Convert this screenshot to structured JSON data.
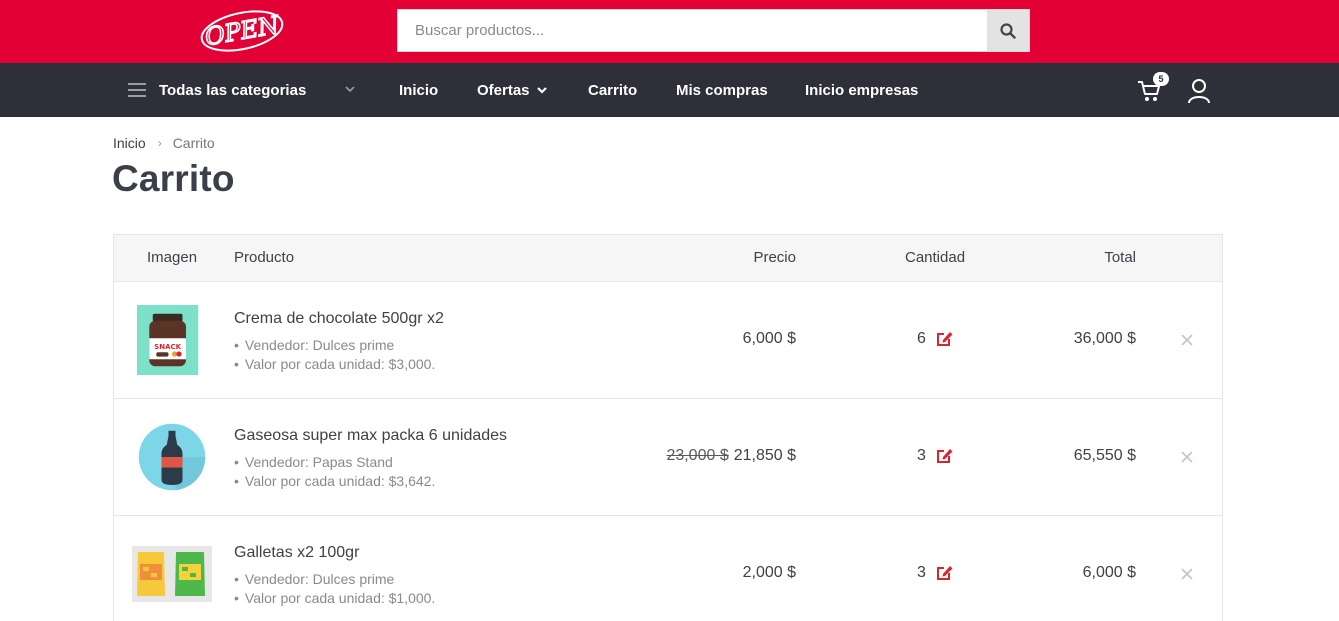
{
  "header": {
    "logo_text": "OPEN",
    "search_placeholder": "Buscar productos..."
  },
  "nav": {
    "categories_label": "Todas las categorias",
    "items": [
      {
        "label": "Inicio"
      },
      {
        "label": "Ofertas"
      },
      {
        "label": "Carrito"
      },
      {
        "label": "Mis compras"
      },
      {
        "label": "Inicio empresas"
      }
    ],
    "cart_count": "5"
  },
  "breadcrumb": {
    "home": "Inicio",
    "current": "Carrito"
  },
  "page_title": "Carrito",
  "table": {
    "headers": {
      "image": "Imagen",
      "product": "Producto",
      "price": "Precio",
      "quantity": "Cantidad",
      "total": "Total"
    },
    "rows": [
      {
        "image": "nutella-jar-image",
        "name": "Crema de chocolate 500gr x2",
        "vendor": "Vendedor: Dulces prime",
        "unit_value": "Valor por cada unidad: $3,000.",
        "old_price": "",
        "price": "6,000 $",
        "quantity": "6",
        "total": "36,000 $"
      },
      {
        "image": "soda-bottle-image",
        "name": "Gaseosa super max packa 6 unidades",
        "vendor": "Vendedor: Papas Stand",
        "unit_value": "Valor por cada unidad: $3,642.",
        "old_price": "23,000 $",
        "price": "21,850 $",
        "quantity": "3",
        "total": "65,550 $"
      },
      {
        "image": "snack-bags-image",
        "name": "Galletas x2 100gr",
        "vendor": "Vendedor: Dulces prime",
        "unit_value": "Valor por cada unidad: $1,000.",
        "old_price": "",
        "price": "2,000 $",
        "quantity": "3",
        "total": "6,000 $"
      }
    ]
  },
  "colors": {
    "brand_red": "#e30035",
    "nav_dark": "#2e2f38",
    "edit_red": "#d9252f"
  },
  "icons": [
    "search-icon",
    "menu-icon",
    "chevron-down-icon",
    "cart-icon",
    "user-icon",
    "edit-icon",
    "close-icon"
  ]
}
